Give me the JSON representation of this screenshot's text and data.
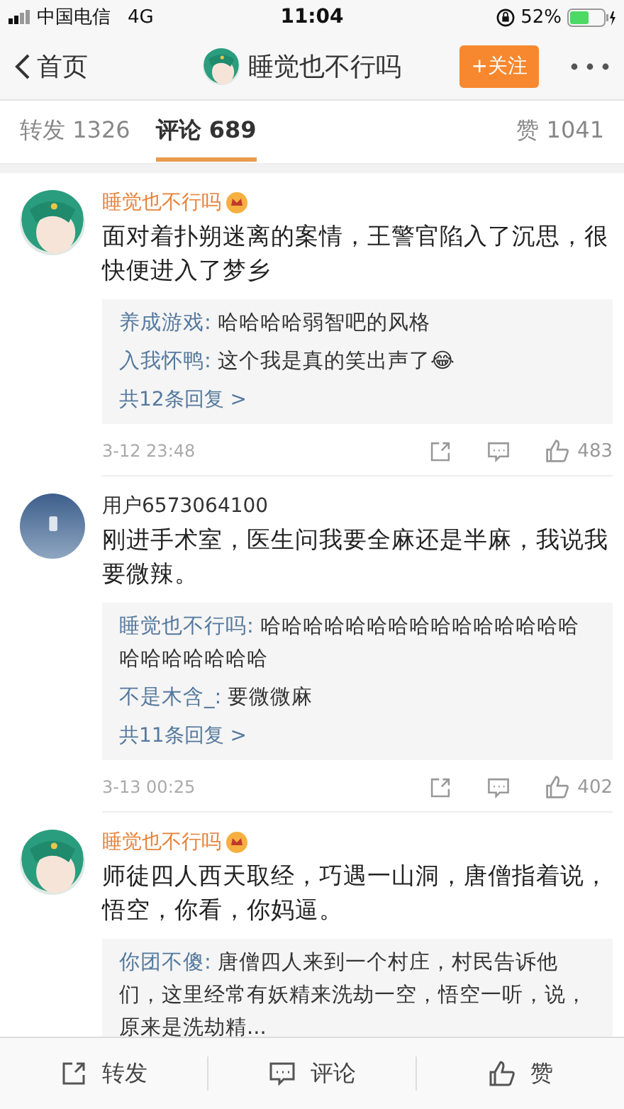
{
  "status_bar": {
    "carrier": "中国电信",
    "network": "4G",
    "time": "11:04",
    "battery": "52%"
  },
  "nav": {
    "back_label": "首页",
    "title": "睡觉也不行吗",
    "avatar": {
      "kind": "anime"
    },
    "follow_button": "+关注"
  },
  "tabs": [
    {
      "label": "转发 1326",
      "selected": false
    },
    {
      "label": "评论 689",
      "selected": true
    },
    {
      "label": "赞 1041",
      "selected": false
    }
  ],
  "comments": [
    {
      "author": "睡觉也不行吗",
      "vip": true,
      "avatar": {
        "kind": "anime"
      },
      "text": "面对着扑朔迷离的案情，王警官陷入了沉思，很快便进入了梦乡",
      "replies": [
        {
          "author": "养成游戏:",
          "text": "哈哈哈哈弱智吧的风格"
        },
        {
          "author": "入我怀鸭:",
          "text": "这个我是真的笑出声了😂"
        }
      ],
      "more_replies": "共12条回复 >",
      "time": "3-12 23:48",
      "likes": "483"
    },
    {
      "author": "用户6573064100",
      "vip": false,
      "avatar": {
        "kind": "photo"
      },
      "text": "刚进手术室，医生问我要全麻还是半麻，我说我要微辣。",
      "replies": [
        {
          "author": "睡觉也不行吗:",
          "text": "哈哈哈哈哈哈哈哈哈哈哈哈哈哈哈哈哈哈哈哈哈哈"
        },
        {
          "author": "不是木含_:",
          "text": "要微微麻"
        }
      ],
      "more_replies": "共11条回复 >",
      "time": "3-13 00:25",
      "likes": "402"
    },
    {
      "author": "睡觉也不行吗",
      "vip": true,
      "avatar": {
        "kind": "anime"
      },
      "text": "师徒四人西天取经，巧遇一山洞，唐僧指着说，悟空，你看，你妈逼。",
      "replies": [
        {
          "author": "你团不傻:",
          "text": "唐僧四人来到一个村庄，村民告诉他们，这里经常有妖精来洗劫一空，悟空一听，说，原来是洗劫精..."
        }
      ]
    }
  ],
  "toolbar": [
    {
      "kind": "repost",
      "label": "转发"
    },
    {
      "kind": "comment",
      "label": "评论"
    },
    {
      "kind": "like",
      "label": "赞"
    }
  ]
}
